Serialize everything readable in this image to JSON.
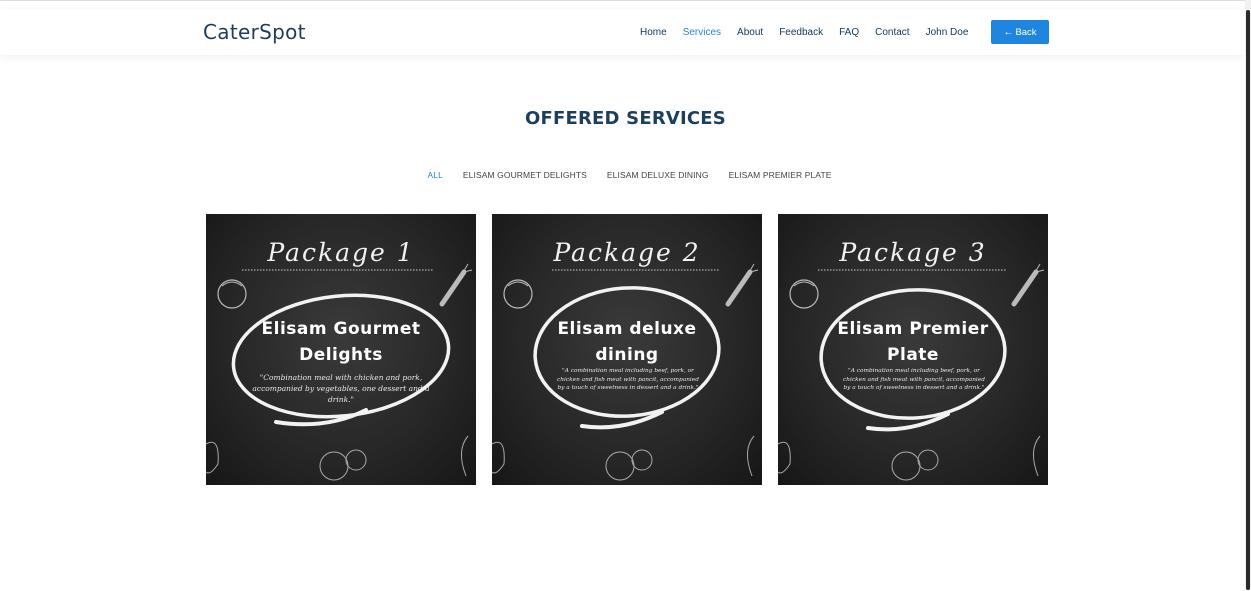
{
  "header": {
    "logo": "CaterSpot",
    "nav": [
      {
        "label": "Home",
        "active": false
      },
      {
        "label": "Services",
        "active": true
      },
      {
        "label": "About",
        "active": false
      },
      {
        "label": "Feedback",
        "active": false
      },
      {
        "label": "FAQ",
        "active": false
      },
      {
        "label": "Contact",
        "active": false
      },
      {
        "label": "John Doe",
        "active": false
      }
    ],
    "back_label": "Back",
    "back_icon": "arrow-left-icon"
  },
  "section": {
    "title": "OFFERED SERVICES"
  },
  "filters": [
    {
      "label": "ALL",
      "active": true
    },
    {
      "label": "ELISAM GOURMET DELIGHTS",
      "active": false
    },
    {
      "label": "ELISAM DELUXE DINING",
      "active": false
    },
    {
      "label": "ELISAM PREMIER PLATE",
      "active": false
    }
  ],
  "packages": [
    {
      "title": "Package 1",
      "name": "Elisam Gourmet Delights",
      "description": "\"Combination meal with chicken and pork, accompanied by vegetables, one dessert and a drink.\""
    },
    {
      "title": "Package 2",
      "name": "Elisam deluxe dining",
      "description": "\"A combination meal including beef, pork, or chicken and fish meat with pancit, accompanied by a touch of sweetness in dessert and a drink.\""
    },
    {
      "title": "Package 3",
      "name": "Elisam Premier Plate",
      "description": "\"A combination meal including beef, pork, or chicken and fish meat with pancit, accompanied by a touch of sweetness in dessert and a drink.\""
    }
  ],
  "colors": {
    "brand": "#1f3d57",
    "accent": "#2a86d6",
    "button": "#1f86e0",
    "card_bg": "#262626"
  }
}
